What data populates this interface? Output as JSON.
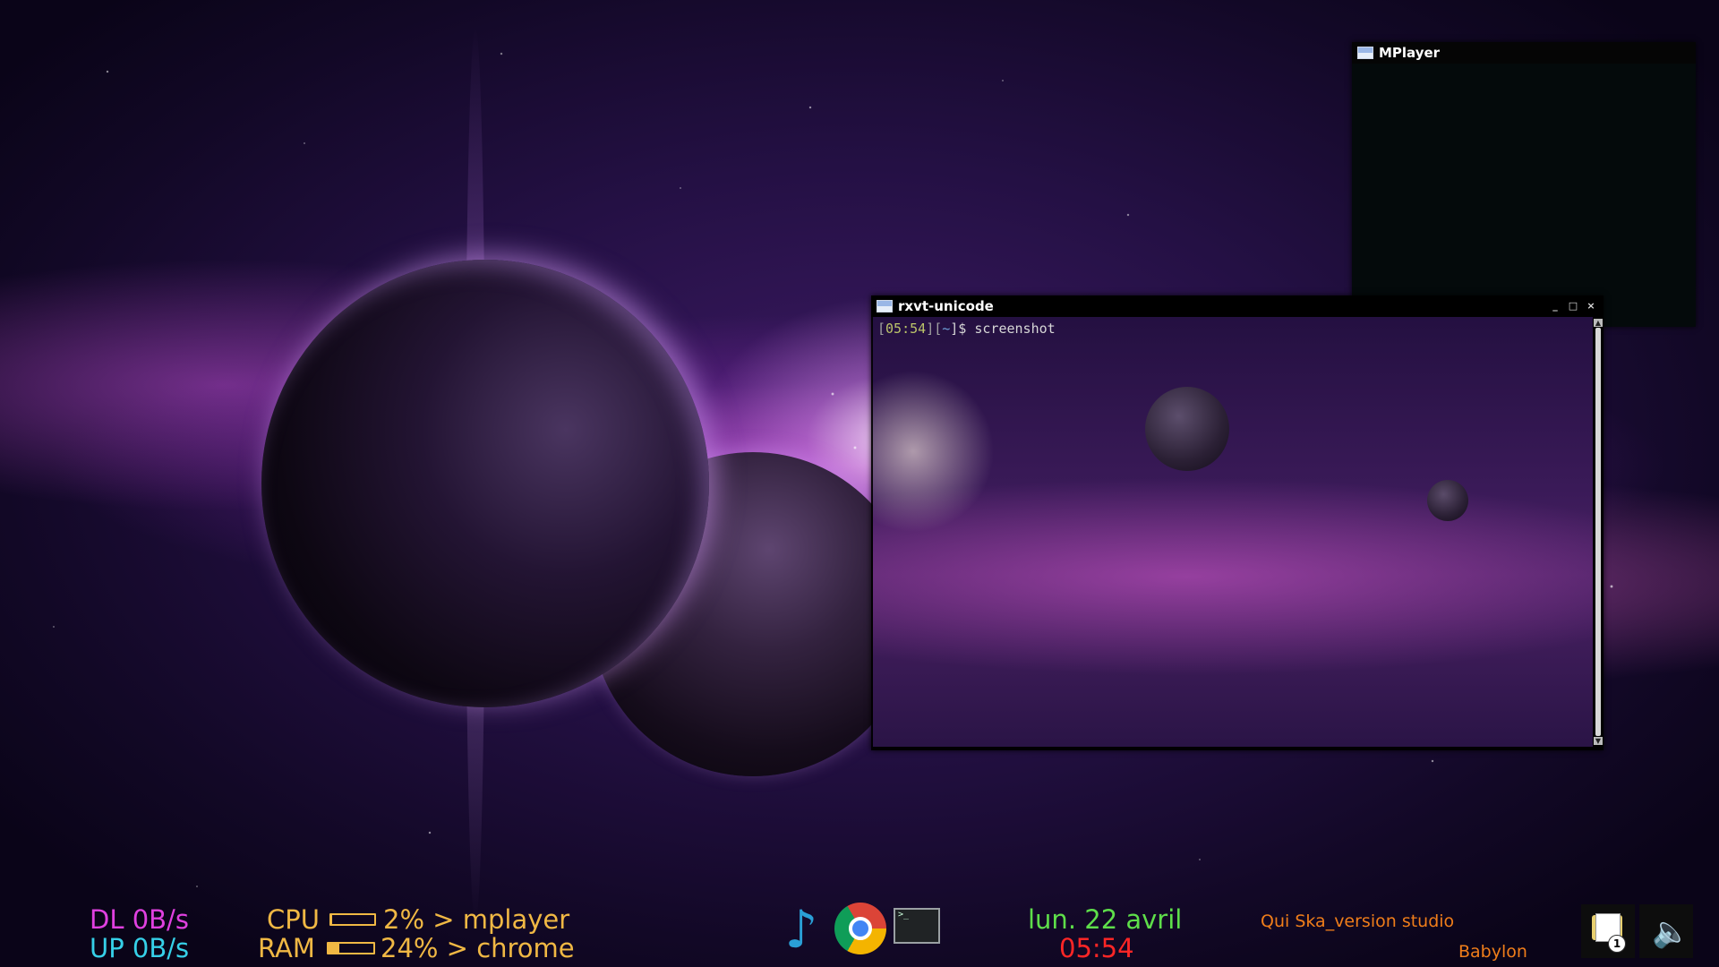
{
  "windows": {
    "mplayer": {
      "title": "MPlayer"
    },
    "terminal": {
      "title": "rxvt-unicode",
      "prompt": {
        "open1": "[",
        "time": "05:54",
        "mid": "][",
        "dir": "~",
        "close": "]$ ",
        "command": "screenshot"
      },
      "controls": {
        "minimize": "_",
        "maximize": "□",
        "close": "×"
      }
    }
  },
  "conky": {
    "net": {
      "dl": "DL 0B/s",
      "up": "UP 0B/s"
    },
    "cpu": {
      "label": "CPU",
      "text": "2% > mplayer",
      "percent": 2
    },
    "ram": {
      "label": "RAM",
      "text": "24% > chrome",
      "percent": 24
    },
    "date": "lun. 22 avril",
    "time": "05:54",
    "music": {
      "track": "Qui Ska_version studio",
      "artist": "Babylon"
    }
  },
  "dock": {
    "items": [
      {
        "name": "music-player",
        "icon": "music-note-icon"
      },
      {
        "name": "chrome",
        "icon": "chrome-icon"
      },
      {
        "name": "terminal",
        "icon": "terminal-icon"
      }
    ]
  },
  "tray": {
    "notifications": {
      "icon": "notification-icon",
      "count": "1"
    },
    "volume": {
      "icon": "speaker-icon"
    }
  },
  "colors": {
    "dl": "#e040e0",
    "up": "#36d0e8",
    "cpu_ram": "#f0b844",
    "date": "#5ede4a",
    "clock": "#ff2626",
    "music": "#ef7d1a"
  }
}
